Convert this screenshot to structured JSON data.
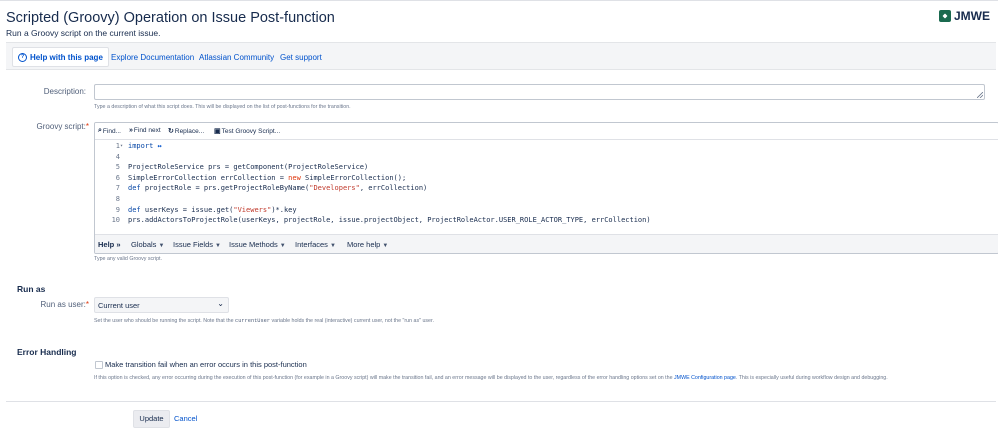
{
  "header": {
    "title": "Scripted (Groovy) Operation on Issue Post-function",
    "subtitle": "Run a Groovy script on the current issue.",
    "logo_text": "JMWE",
    "logo_icon": "jmwe-logo-icon"
  },
  "helpbar": {
    "active_tab": "Help with this page",
    "links": [
      "Explore Documentation",
      "Atlassian Community",
      "Get support"
    ]
  },
  "form": {
    "description": {
      "label": "Description:",
      "value": "",
      "hint": "Type a description of what this script does. This will be displayed on the list of post-functions for the transition."
    },
    "script": {
      "label": "Groovy script:",
      "required_mark": "*",
      "toolbar": {
        "find": "Find...",
        "find_next": "Find next",
        "replace": "Replace...",
        "test": "Test Groovy Script..."
      },
      "lines": [
        {
          "n": "1",
          "fold": "▾",
          "parts": [
            {
              "t": "import ",
              "c": "kw"
            },
            {
              "t": "↔",
              "c": "ellip"
            }
          ]
        },
        {
          "n": "4",
          "fold": "",
          "parts": []
        },
        {
          "n": "5",
          "fold": "",
          "parts": [
            {
              "t": "ProjectRoleService prs = getComponent(ProjectRoleService)",
              "c": ""
            }
          ]
        },
        {
          "n": "6",
          "fold": "",
          "parts": [
            {
              "t": "SimpleErrorCollection errCollection = ",
              "c": ""
            },
            {
              "t": "new",
              "c": "kw2"
            },
            {
              "t": " SimpleErrorCollection();",
              "c": ""
            }
          ]
        },
        {
          "n": "7",
          "fold": "",
          "parts": [
            {
              "t": "def",
              "c": "kw"
            },
            {
              "t": " projectRole = prs.getProjectRoleByName(",
              "c": ""
            },
            {
              "t": "\"Developers\"",
              "c": "str"
            },
            {
              "t": ", errCollection)",
              "c": ""
            }
          ]
        },
        {
          "n": "8",
          "fold": "",
          "parts": []
        },
        {
          "n": "9",
          "fold": "",
          "parts": [
            {
              "t": "def",
              "c": "kw"
            },
            {
              "t": " userKeys = issue.get(",
              "c": ""
            },
            {
              "t": "\"Viewers\"",
              "c": "str"
            },
            {
              "t": ")*.key",
              "c": ""
            }
          ]
        },
        {
          "n": "10",
          "fold": "",
          "parts": [
            {
              "t": "prs.addActorsToProjectRole(userKeys, projectRole, issue.projectObject, ProjectRoleActor.USER_ROLE_ACTOR_TYPE, errCollection)",
              "c": ""
            }
          ]
        }
      ],
      "helpbar": {
        "help": "Help",
        "menus": [
          "Globals",
          "Issue Fields",
          "Issue Methods",
          "Interfaces",
          "More help"
        ]
      },
      "hint": "Type any valid Groovy script."
    }
  },
  "run_as": {
    "section_title": "Run as",
    "label": "Run as user:",
    "required_mark": "*",
    "selected": "Current user",
    "hint_before": "Set the user who should be running the script. Note that the ",
    "hint_code": "currentUser",
    "hint_after": " variable holds the real (interactive) current user, not the \"run as\" user."
  },
  "error_handling": {
    "section_title": "Error Handling",
    "checkbox_label": "Make transition fail when an error occurs in this post-function",
    "checked": false,
    "hint_before": "If this option is checked, any error occurring during the execution of this post-function (for example in a Groovy script) will make the transition fail, and an error message will be displayed to the user, regardless of the error handling options set on the ",
    "hint_link": "JMWE Configuration page",
    "hint_after": ". This is especially useful during workflow design and debugging."
  },
  "actions": {
    "update": "Update",
    "cancel": "Cancel"
  },
  "colors": {
    "link": "#0052cc",
    "text": "#172b4d",
    "required": "#de350b",
    "logo": "#1a6a4f"
  }
}
